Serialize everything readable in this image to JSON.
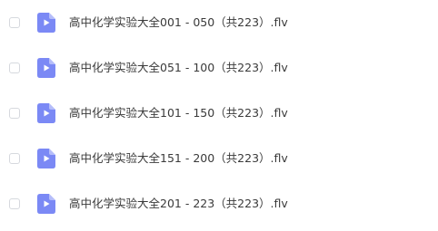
{
  "files": [
    {
      "name": "高中化学实验大全001 - 050（共223）.flv",
      "icon": "video-file-icon",
      "selected": false
    },
    {
      "name": "高中化学实验大全051 - 100（共223）.flv",
      "icon": "video-file-icon",
      "selected": false
    },
    {
      "name": "高中化学实验大全101 - 150（共223）.flv",
      "icon": "video-file-icon",
      "selected": false
    },
    {
      "name": "高中化学实验大全151 - 200（共223）.flv",
      "icon": "video-file-icon",
      "selected": false
    },
    {
      "name": "高中化学实验大全201 - 223（共223）.flv",
      "icon": "video-file-icon",
      "selected": false
    }
  ],
  "colors": {
    "icon_bg": "#7b89f5",
    "icon_fold": "#b5bdfa",
    "checkbox_border": "#d6d9de",
    "text": "#3a3a3a"
  }
}
